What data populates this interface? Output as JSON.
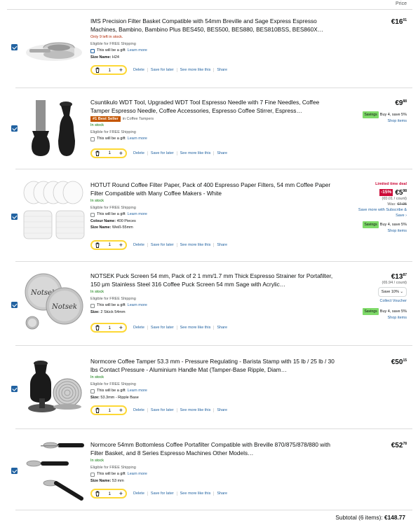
{
  "header": {
    "price_label": "Price"
  },
  "common": {
    "gift_text": "This will be a gift",
    "learn_more": "Learn more",
    "delete": "Delete",
    "save_later": "Save for later",
    "see_more": "See more like this",
    "share": "Share",
    "savings_label": "Savings",
    "buy4": "Buy 4, save 5%",
    "shop_items": "Shop items"
  },
  "items": [
    {
      "title": "IMS Precision Filter Basket Compatible with 54mm Breville and Sage Express Espresso Machines, Bambino, Bambino Plus BES450, BES500, BES880, BES810BSS, BES860X…",
      "stock": "Only 9 left in stock.",
      "shipping": "Eligible for FREE Shipping",
      "spec_label": "Size Name:",
      "spec_value": "H24",
      "qty": "1",
      "price_whole": "€16",
      "price_frac": "01"
    },
    {
      "title": "Csuntikulo WDT Tool, Upgraded WDT Tool Espresso Needle with 7 Fine Needles, Coffee Tamper Espresso Needle, Coffee Accessories, Espresso Coffee Stirrer, Espress…",
      "badge": "#1 Best Seller",
      "badge_cat": "in Coffee Tampers",
      "stock": "In stock",
      "shipping": "Eligible for FREE Shipping",
      "qty": "1",
      "price_whole": "€9",
      "price_frac": "88"
    },
    {
      "title": "HOTUT Round Coffee Filter Paper, Pack of 400 Espresso Paper Filters, 54 mm Coffee Paper Filter Compatible with Many Coffee Makers - White",
      "stock": "In stock",
      "shipping": "Eligible for FREE Shipping",
      "spec1_label": "Colour Name:",
      "spec1_value": "400 Pieces",
      "spec2_label": "Size Name:",
      "spec2_value": "Weiß-55mm",
      "qty": "1",
      "deal": "Limited time deal",
      "discount": "-15%",
      "price_whole": "€5",
      "price_frac": "98",
      "unit_price": "(€0.01 / count)",
      "was_label": "Was:",
      "was_price": "€7.05",
      "subscribe": "Save more with Subscribe &",
      "subscribe2": "Save"
    },
    {
      "title": "NOTSEK Puck Screen 54 mm, Pack of 2 1 mm/1.7 mm Thick Espresso Strainer for Portafilter, 150 μm Stainless Steel 316 Coffee Puck Screen 54 mm Sage with Acrylic…",
      "stock": "In stock",
      "shipping": "Eligible for FREE Shipping",
      "spec_label": "Size:",
      "spec_value": "2 Stück 54mm",
      "qty": "1",
      "price_whole": "€13",
      "price_frac": "87",
      "unit_price": "(€6.94 / count)",
      "voucher_select": "Save 10%",
      "voucher_btn": "Collect Voucher"
    },
    {
      "title": "Normcore Coffee Tamper 53.3 mm - Pressure Regulating - Barista Stamp with 15 lb / 25 lb / 30 lbs Contact Pressure - Aluminium Handle Mat (Tamper-Base Ripple, Diam…",
      "stock": "In stock",
      "shipping": "Eligible for FREE Shipping",
      "spec_label": "Size:",
      "spec_value": "53.3mm - Ripple Base",
      "qty": "1",
      "price_whole": "€50",
      "price_frac": "15"
    },
    {
      "title": "Normcore 54mm Bottomless Coffee Portafilter Compatible with Breville 870/875/878/880 with Filter Basket, and 8 Series Espresso Machines Other Models…",
      "stock": "In stock",
      "shipping": "Eligible for FREE Shipping",
      "spec_label": "Size Name:",
      "spec_value": "53 mm",
      "qty": "1",
      "price_whole": "€52",
      "price_frac": "78"
    }
  ],
  "subtotal": {
    "label": "Subtotal (6 items):",
    "amount": "€148.77"
  }
}
